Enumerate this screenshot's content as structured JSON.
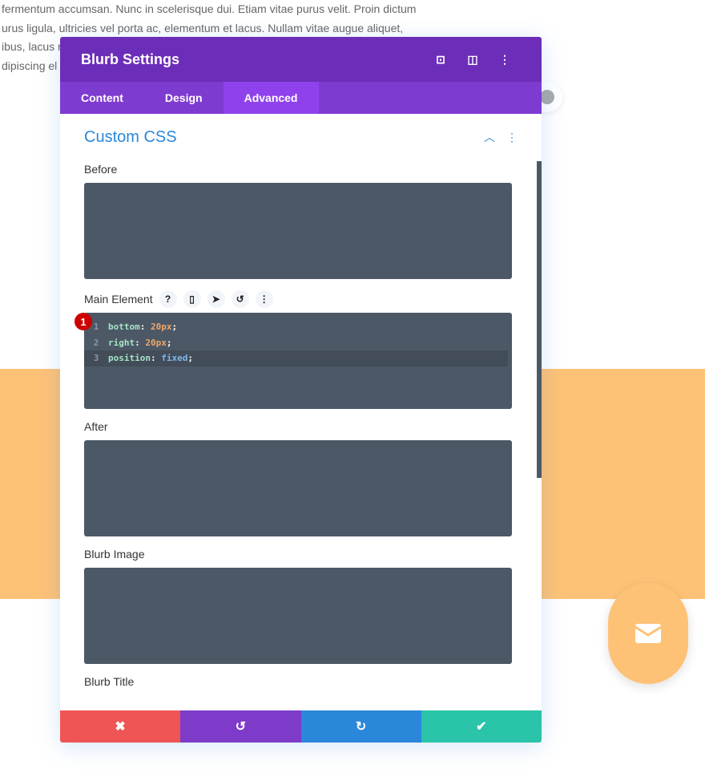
{
  "background": {
    "lines": [
      "fermentum accumsan. Nunc in scelerisque dui. Etiam vitae purus velit. Proin dictum",
      "urus ligula, ultricies vel porta ac, elementum et lacus. Nullam vitae augue aliquet,",
      "ibus, lacus r",
      "dipiscing el"
    ],
    "band_color": "#fec277"
  },
  "modal": {
    "title": "Blurb Settings",
    "header_icons": [
      "focus-icon",
      "split-view-icon",
      "more-vertical-icon"
    ],
    "tabs": [
      {
        "label": "Content"
      },
      {
        "label": "Design"
      },
      {
        "label": "Advanced",
        "active": true
      }
    ],
    "section": {
      "title": "Custom CSS"
    },
    "fields": {
      "before": "Before",
      "main": "Main Element",
      "after": "After",
      "image": "Blurb Image",
      "title": "Blurb Title"
    },
    "badge": "1",
    "code": [
      {
        "n": "1",
        "prop": "bottom",
        "val": "20px"
      },
      {
        "n": "2",
        "prop": "right",
        "val": "20px"
      },
      {
        "n": "3",
        "prop": "position",
        "val": "fixed"
      }
    ],
    "footer": {
      "cancel": "✖",
      "undo": "↺",
      "redo": "↻",
      "save": "✔"
    }
  },
  "colors": {
    "header": "#6c2eb9",
    "tabs": "#7e3bd0",
    "cancel": "#ef5555",
    "undo": "#7e3bc9",
    "redo": "#2b87da",
    "save": "#29c4a9"
  }
}
